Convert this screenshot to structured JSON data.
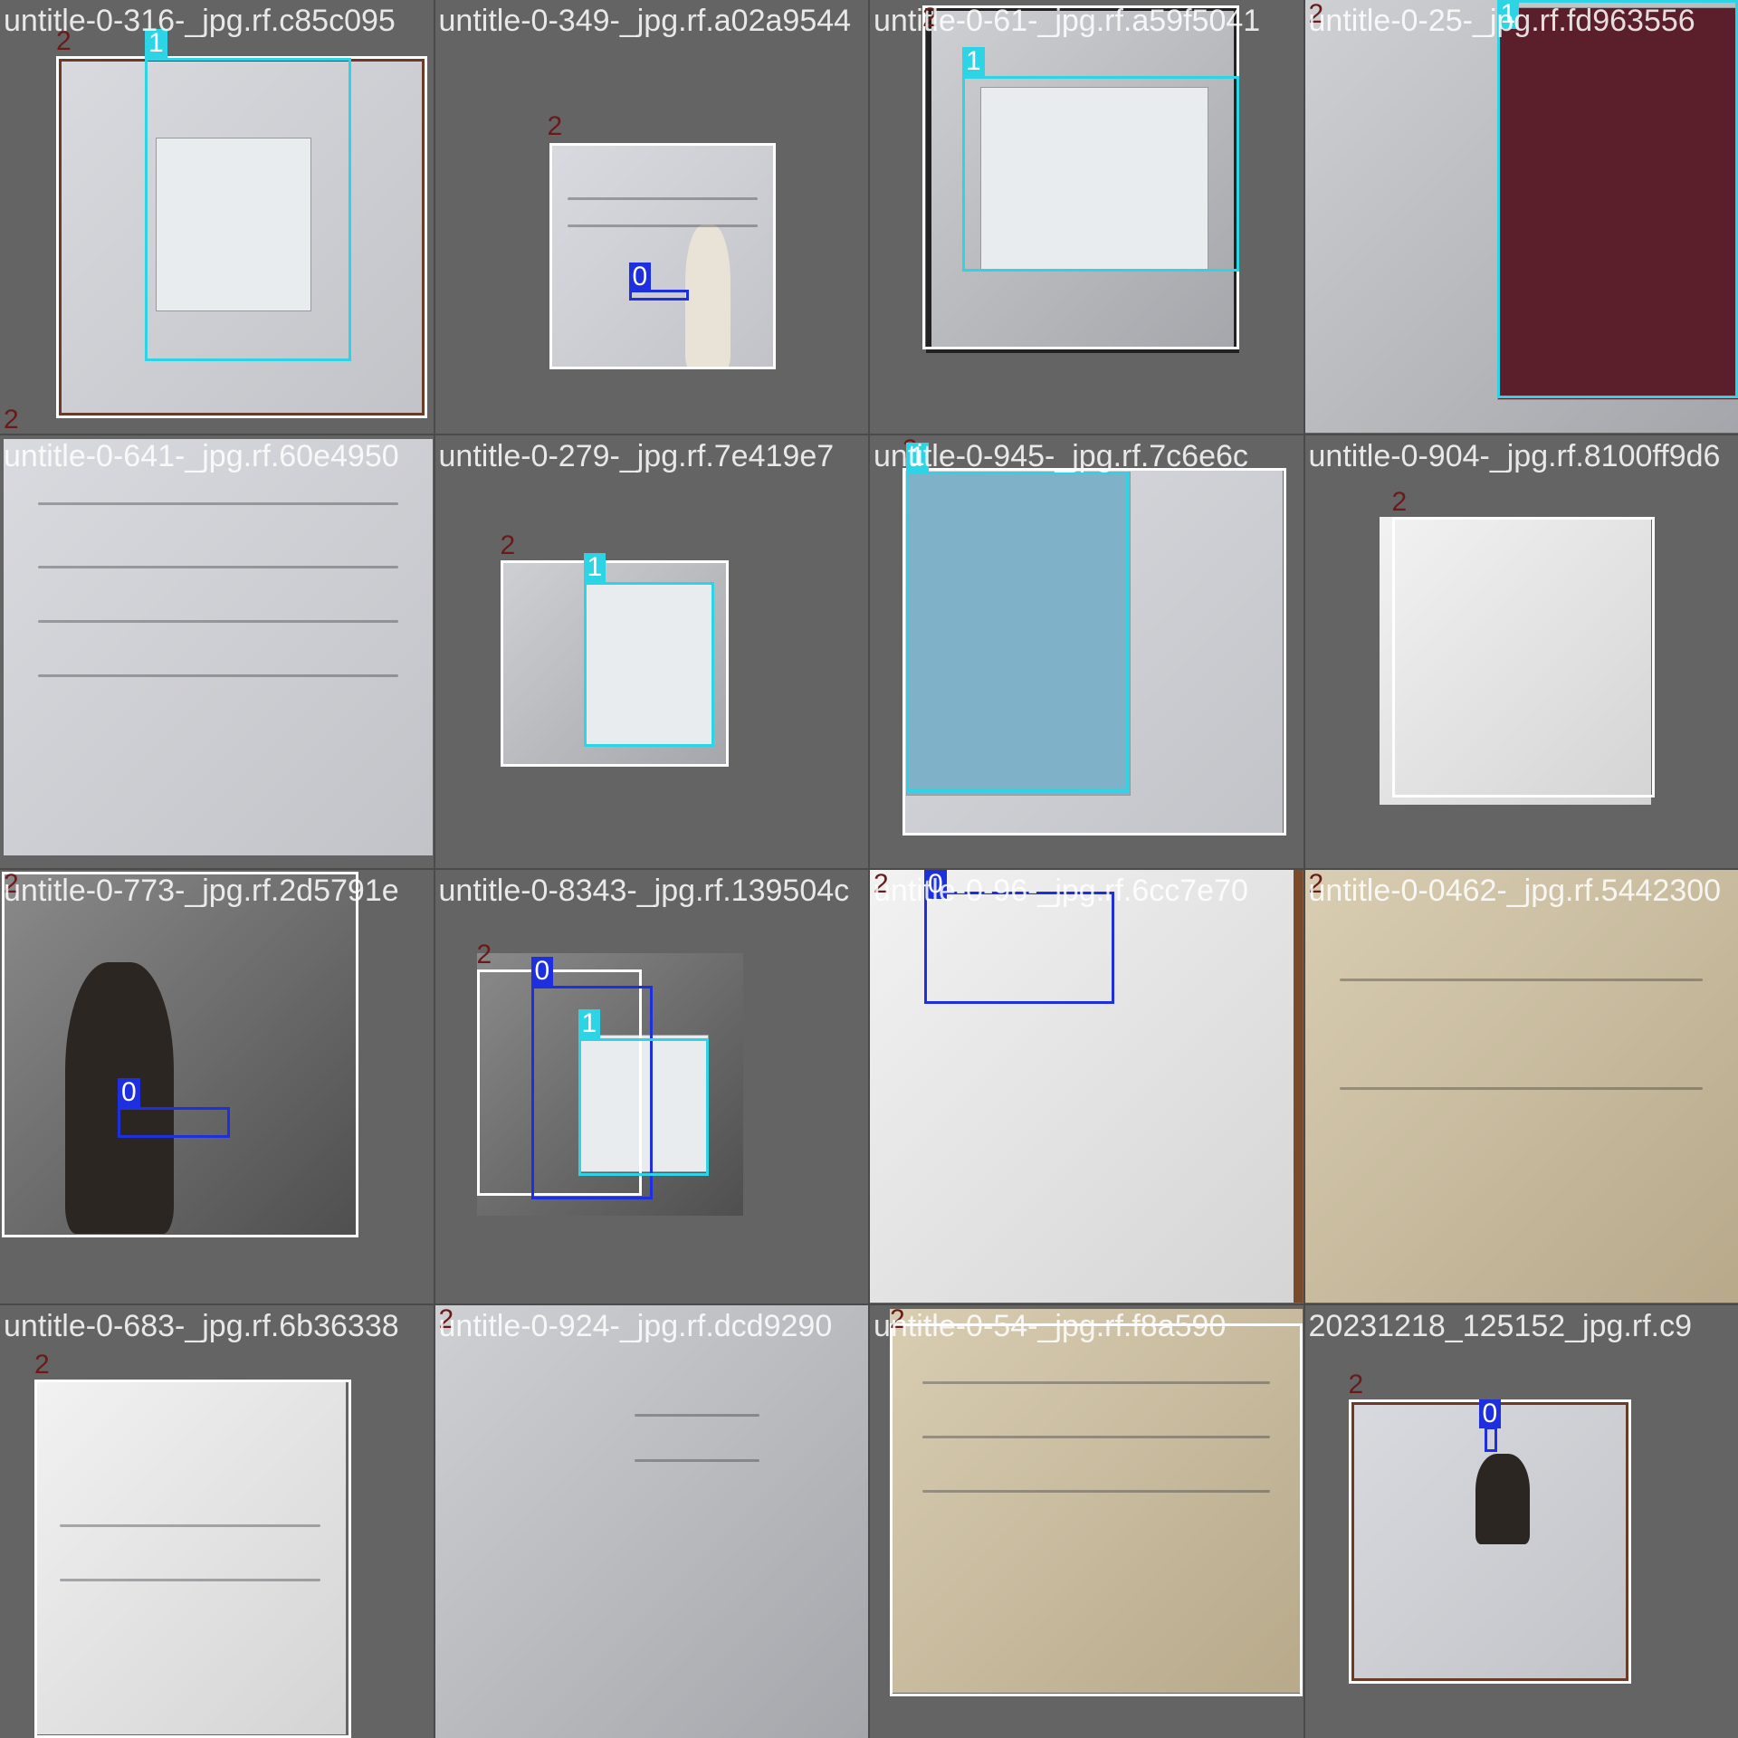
{
  "class_colors": {
    "0": "#1e2fe0",
    "1": "#2cd4e6",
    "2": "#ffffff"
  },
  "tiles": [
    {
      "filename": "untitle-0-316-_jpg.rf.c85c095",
      "scene": "light",
      "labels": [
        "2",
        "1",
        "2"
      ]
    },
    {
      "filename": "untitle-0-349-_jpg.rf.a02a9544",
      "scene": "light",
      "labels": [
        "2",
        "0"
      ]
    },
    {
      "filename": "untitle-0-61-_jpg.rf.a59f5041",
      "scene": "gray",
      "labels": [
        "2",
        "1"
      ]
    },
    {
      "filename": "untitle-0-25-_jpg.rf.fd963556",
      "scene": "gray",
      "labels": [
        "2",
        "1"
      ]
    },
    {
      "filename": "untitle-0-641-_jpg.rf.60e4950",
      "scene": "light",
      "labels": [
        "2"
      ]
    },
    {
      "filename": "untitle-0-279-_jpg.rf.7e419e7",
      "scene": "gray",
      "labels": [
        "2",
        "1"
      ]
    },
    {
      "filename": "untitle-0-945-_jpg.rf.7c6e6c",
      "scene": "light",
      "labels": [
        "2",
        "1"
      ]
    },
    {
      "filename": "untitle-0-904-_jpg.rf.8100ff9d6",
      "scene": "white",
      "labels": [
        "2"
      ]
    },
    {
      "filename": "untitle-0-773-_jpg.rf.2d5791e",
      "scene": "dark",
      "labels": [
        "2",
        "0"
      ]
    },
    {
      "filename": "untitle-0-8343-_jpg.rf.139504c",
      "scene": "dark",
      "labels": [
        "2",
        "0",
        "1"
      ]
    },
    {
      "filename": "untitle-0-96-_jpg.rf.6cc7e70",
      "scene": "white",
      "labels": [
        "2",
        "0"
      ]
    },
    {
      "filename": "untitle-0-0462-_jpg.rf.5442300",
      "scene": "warm",
      "labels": [
        "2"
      ]
    },
    {
      "filename": "untitle-0-683-_jpg.rf.6b36338",
      "scene": "white",
      "labels": [
        "2"
      ]
    },
    {
      "filename": "untitle-0-924-_jpg.rf.dcd9290",
      "scene": "gray",
      "labels": [
        "2"
      ]
    },
    {
      "filename": "untitle-0-54-_jpg.rf.f8a590",
      "scene": "warm",
      "labels": [
        "2"
      ]
    },
    {
      "filename": "20231218_125152_jpg.rf.c9",
      "scene": "light",
      "labels": [
        "2",
        "0"
      ]
    }
  ]
}
